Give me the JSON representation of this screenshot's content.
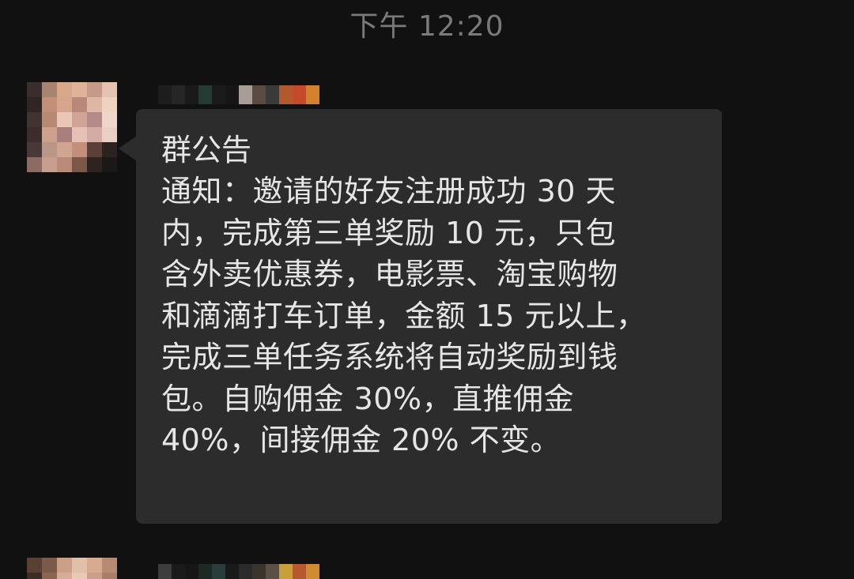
{
  "chat": {
    "timestamp": "下午 12:20",
    "message": {
      "title": "群公告",
      "lines": [
        "通知：邀请的好友注册成功 30 天",
        "内，完成第三单奖励 10 元，只包",
        "含外卖优惠券，电影票、淘宝购物",
        "和滴滴打车订单，金额 15 元以上，",
        "完成三单任务系统将自动奖励到钱",
        "包。自购佣金 30%，直推佣金",
        "40%，间接佣金 20% 不变。"
      ]
    }
  },
  "colors": {
    "background": "#111111",
    "bubble": "#2c2c2c",
    "text": "#e6e6e6",
    "timestamp": "#7a7a7a"
  },
  "icons": {
    "avatar": "pixelated-avatar",
    "sender_name": "pixelated-name"
  }
}
